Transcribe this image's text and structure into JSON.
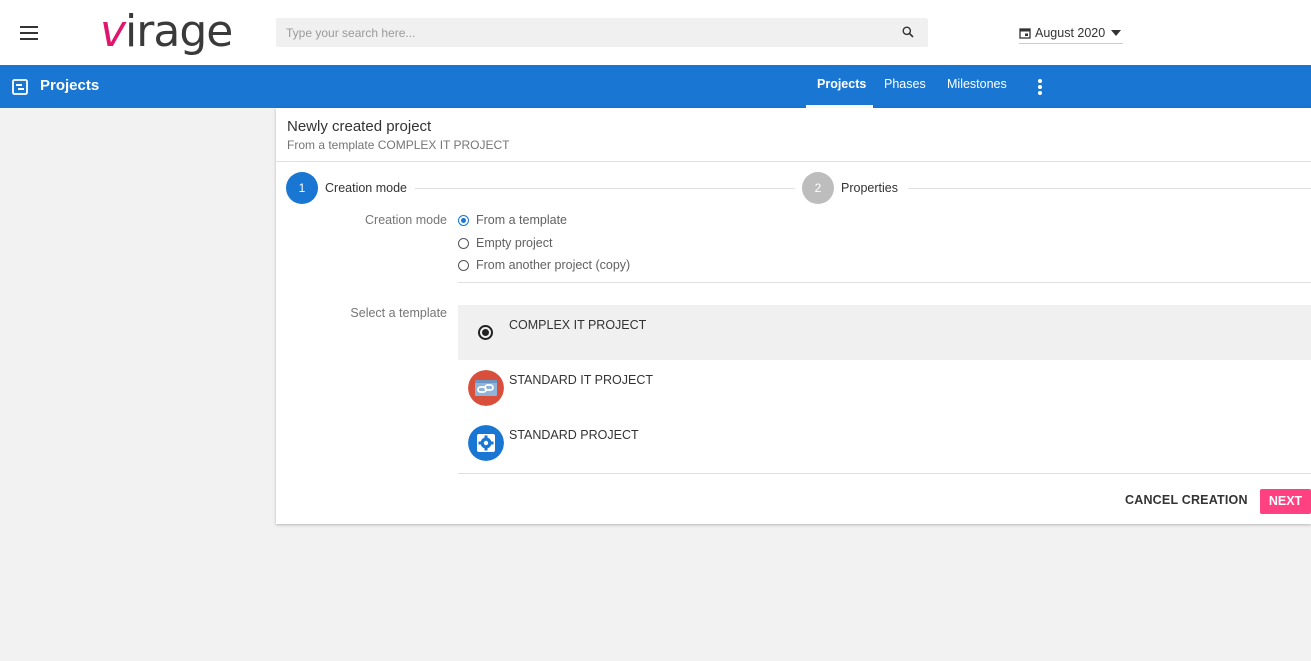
{
  "header": {
    "logo_accent": "v",
    "logo_rest": "irage",
    "search_placeholder": "Type your search here...",
    "period": "August 2020"
  },
  "nav": {
    "title": "Projects",
    "tabs": [
      {
        "label": "Projects",
        "active": true
      },
      {
        "label": "Phases",
        "active": false
      },
      {
        "label": "Milestones",
        "active": false
      }
    ]
  },
  "card": {
    "title": "Newly created project",
    "subtitle": "From a template COMPLEX IT PROJECT",
    "steps": [
      {
        "number": "1",
        "label": "Creation mode",
        "active": true
      },
      {
        "number": "2",
        "label": "Properties",
        "active": false
      }
    ],
    "creation_mode": {
      "label": "Creation mode",
      "options": [
        {
          "label": "From a template",
          "selected": true
        },
        {
          "label": "Empty project",
          "selected": false
        },
        {
          "label": "From another project (copy)",
          "selected": false
        }
      ]
    },
    "template": {
      "label": "Select a template",
      "items": [
        {
          "name": "COMPLEX IT PROJECT",
          "selected": true,
          "icon": "radio-selected-icon"
        },
        {
          "name": "STANDARD IT PROJECT",
          "selected": false,
          "icon": "link-icon"
        },
        {
          "name": "STANDARD PROJECT",
          "selected": false,
          "icon": "gear-icon"
        }
      ]
    },
    "actions": {
      "cancel": "CANCEL CREATION",
      "next": "NEXT"
    }
  },
  "colors": {
    "primary": "#1976d2",
    "accent": "#ff4081",
    "logo_accent": "#e0156e",
    "step_inactive": "#bdbdbd",
    "standard_it_icon_bg": "#d84f3b",
    "standard_icon_bg": "#1976d2"
  }
}
